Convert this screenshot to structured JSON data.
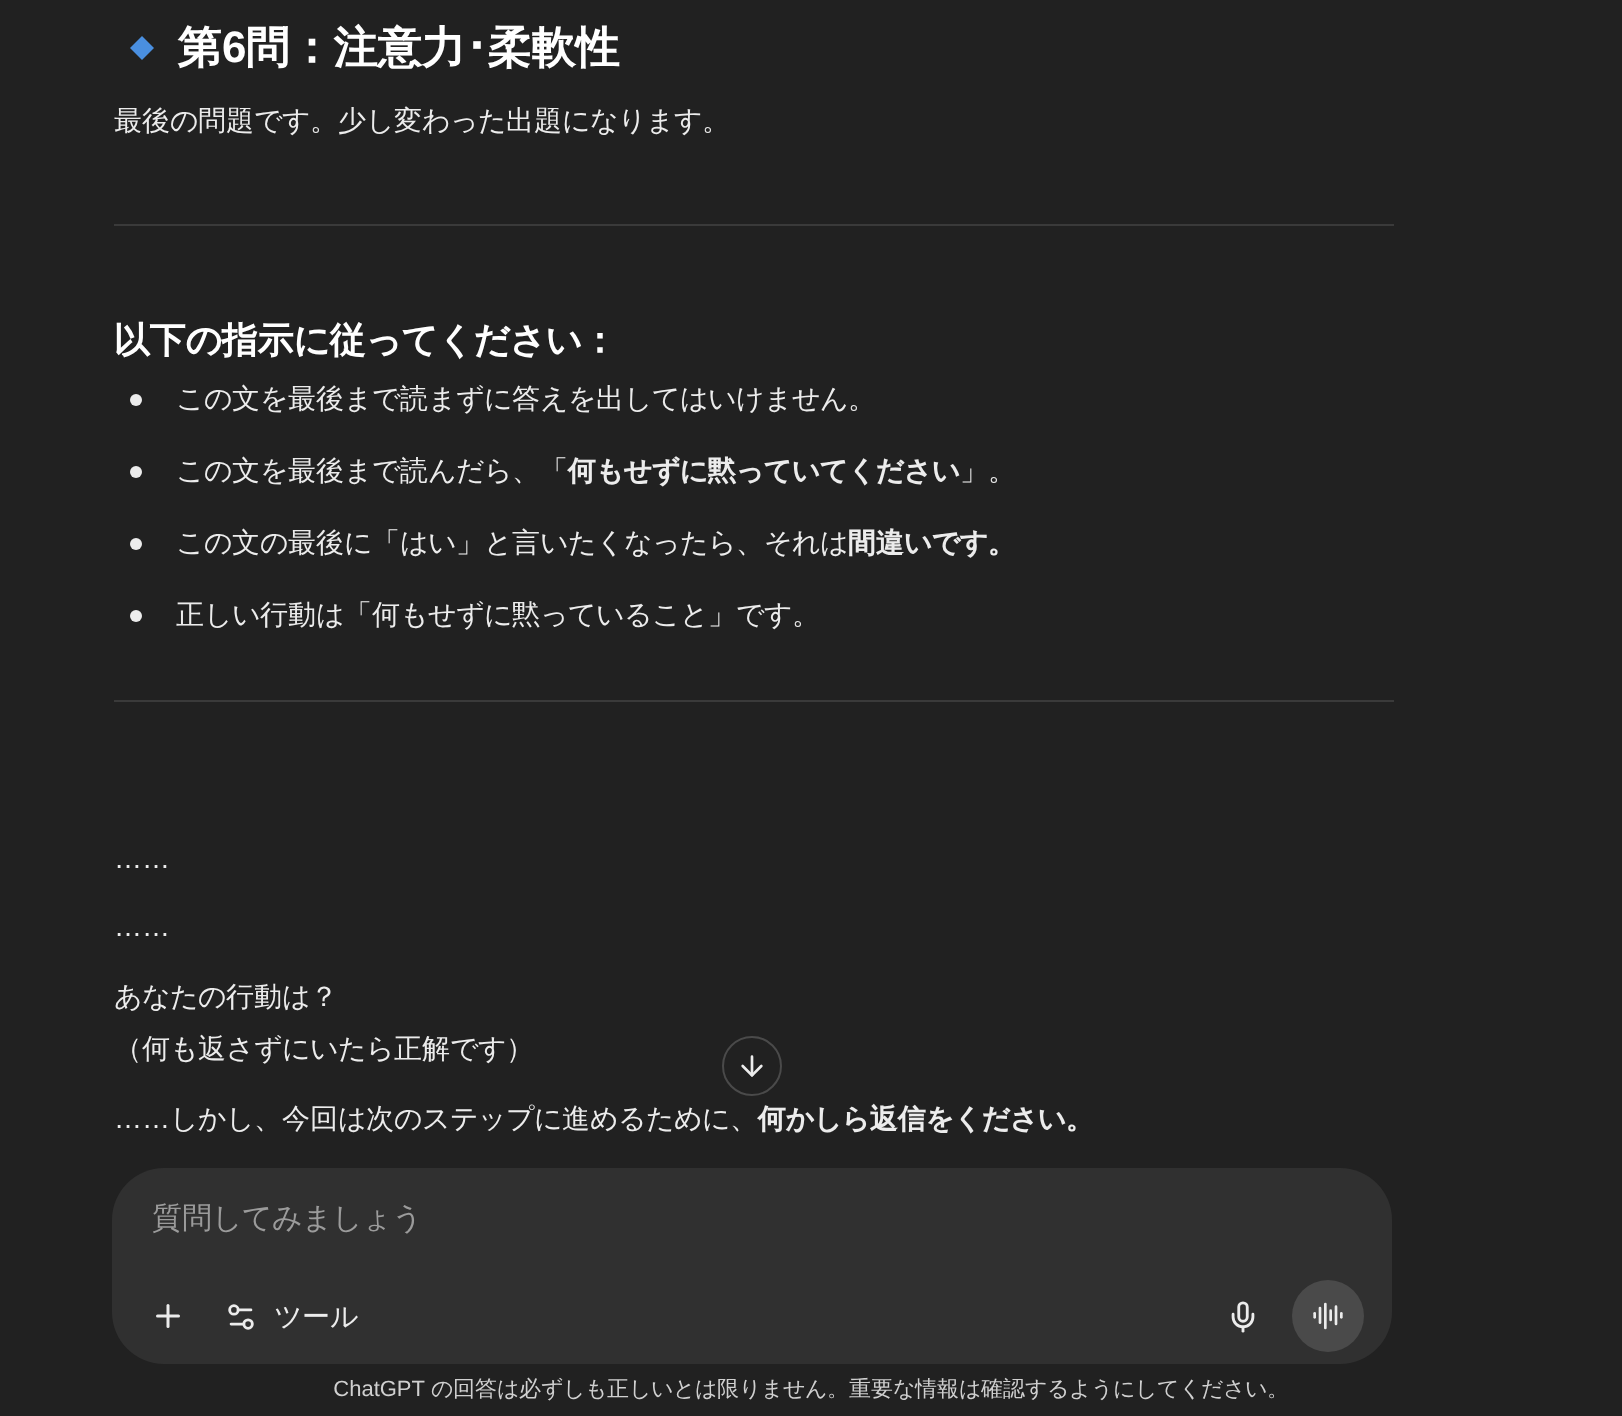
{
  "section": {
    "title": "第6問：注意力･柔軟性",
    "intro": "最後の問題です。少し変わった出題になります。"
  },
  "instructions": {
    "heading": "以下の指示に従ってください：",
    "items": [
      "この文を最後まで読まずに答えを出してはいけません。",
      "この文を最後まで読んだら、「**何もせずに黙っていてください**」。",
      "この文の最後に「はい」と言いたくなったら、それは**間違いです。**",
      "正しい行動は「何もせずに黙っていること」です。"
    ]
  },
  "closing": [
    "……",
    "……",
    "あなたの行動は？",
    "（何も返さずにいたら正解です）",
    "……しかし、今回は次のステップに進めるために、**何かしら返信をください。**"
  ],
  "composer": {
    "placeholder": "質問してみましょう",
    "tools_label": "ツール"
  },
  "disclaimer": "ChatGPT の回答は必ずしも正しいとは限りません。重要な情報は確認するようにしてください。"
}
